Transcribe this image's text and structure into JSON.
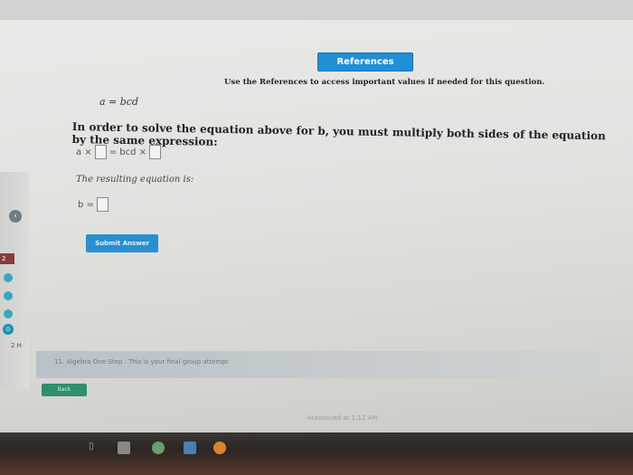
{
  "references_button": "References",
  "references_note": "Use the References to access important values if needed for this question.",
  "equation": "a = bcd",
  "prompt": "In order to solve the equation above for b, you must multiply both sides of the equation by the same expression:",
  "row1": {
    "left": "a ×",
    "middle": "= bcd ×"
  },
  "resulting_label": "The resulting equation is:",
  "row2": {
    "left": "b ="
  },
  "submit_button": "Submit Answer",
  "footer_text": "11. Algebra One-Step : This is your final group attempt",
  "back_button": "Back",
  "autosaved": "Autosaved at 1:12 AM",
  "sidebar": {
    "tag_left": "2",
    "label_bottom": "2 H"
  },
  "colors": {
    "accent_blue": "#1f8fd8",
    "back_green": "#2f8f6a"
  }
}
